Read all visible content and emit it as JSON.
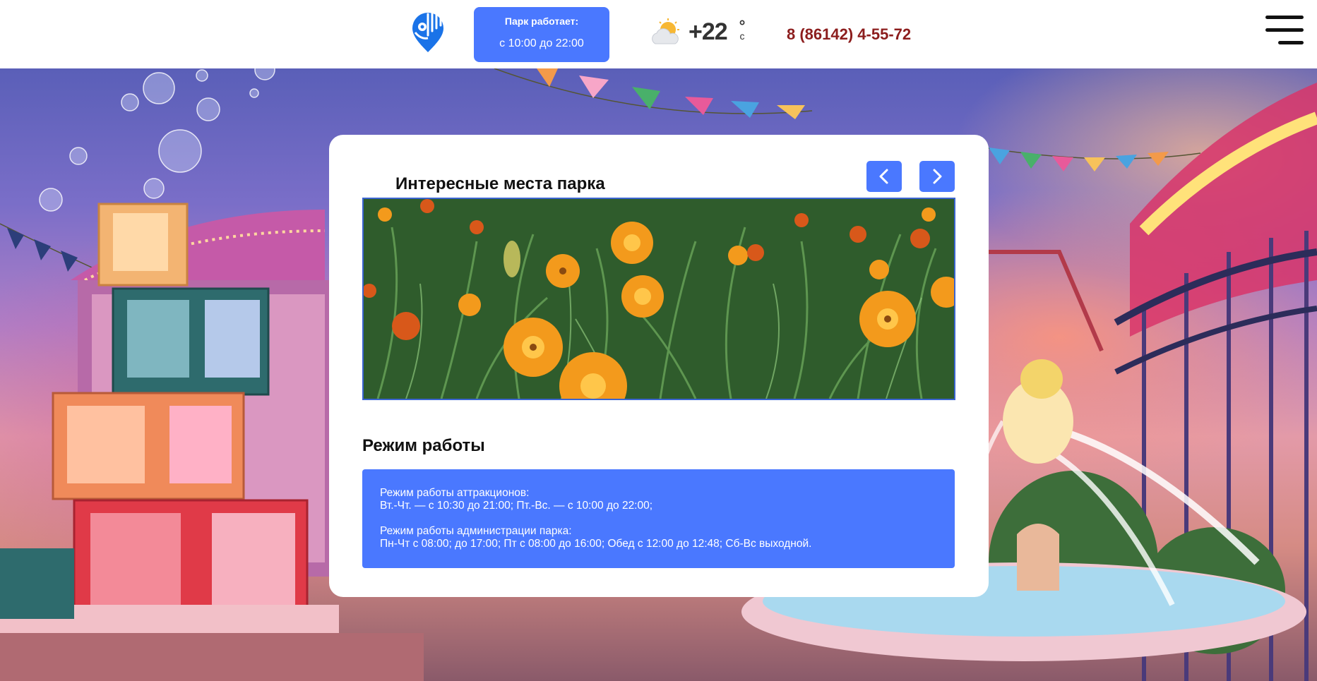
{
  "header": {
    "hours_title": "Парк работает:",
    "hours_value": "с 10:00 до 22:00",
    "temperature": "+22",
    "temperature_degree": "°",
    "temperature_unit": "c",
    "phone": "8 (86142) 4-55-72",
    "logo_icon": "park-logo-icon",
    "weather_icon": "partly-cloudy-icon",
    "menu_icon": "hamburger-menu-icon"
  },
  "gallery": {
    "title": "Интересные места парка",
    "prev_icon": "chevron-left-icon",
    "next_icon": "chevron-right-icon"
  },
  "schedule": {
    "title": "Режим работы",
    "attractions_heading": "Режим работы аттракционов:",
    "attractions_hours": "Вт.-Чт. — с 10:30 до 21:00; Пт.-Вс. — с 10:00 до 22:00;",
    "admin_heading": "Режим работы администрации парка:",
    "admin_hours": "Пн-Чт с 08:00; до 17:00; Пт с 08:00 до 16:00; Обед с 12:00 до 12:48; Сб-Вс выходной."
  },
  "colors": {
    "accent": "#4a78ff",
    "phone": "#8c1d1d",
    "logo": "#1a73e8"
  }
}
